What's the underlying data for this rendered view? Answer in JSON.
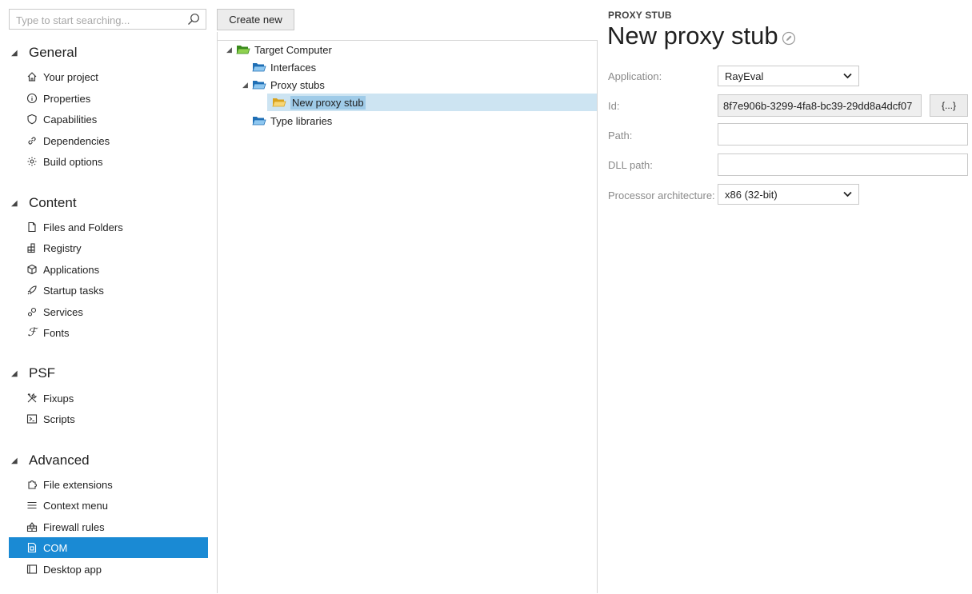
{
  "search": {
    "placeholder": "Type to start searching..."
  },
  "toolbar": {
    "create_label": "Create new"
  },
  "sidebar": {
    "sections": [
      {
        "label": "General",
        "items": [
          {
            "label": "Your project",
            "icon": "home-icon"
          },
          {
            "label": "Properties",
            "icon": "info-icon"
          },
          {
            "label": "Capabilities",
            "icon": "shield-icon"
          },
          {
            "label": "Dependencies",
            "icon": "link-icon"
          },
          {
            "label": "Build options",
            "icon": "gear-icon"
          }
        ]
      },
      {
        "label": "Content",
        "items": [
          {
            "label": "Files and Folders",
            "icon": "file-icon"
          },
          {
            "label": "Registry",
            "icon": "registry-icon"
          },
          {
            "label": "Applications",
            "icon": "package-icon"
          },
          {
            "label": "Startup tasks",
            "icon": "rocket-icon"
          },
          {
            "label": "Services",
            "icon": "services-icon"
          },
          {
            "label": "Fonts",
            "icon": "font-icon"
          }
        ]
      },
      {
        "label": "PSF",
        "items": [
          {
            "label": "Fixups",
            "icon": "tools-icon"
          },
          {
            "label": "Scripts",
            "icon": "script-icon"
          }
        ]
      },
      {
        "label": "Advanced",
        "items": [
          {
            "label": "File extensions",
            "icon": "puzzle-icon"
          },
          {
            "label": "Context menu",
            "icon": "menu-icon"
          },
          {
            "label": "Firewall rules",
            "icon": "firewall-icon"
          },
          {
            "label": "COM",
            "icon": "com-icon",
            "active": true
          },
          {
            "label": "Desktop app",
            "icon": "desktop-icon"
          }
        ]
      }
    ]
  },
  "tree": {
    "root": "Target Computer",
    "interfaces": "Interfaces",
    "proxy_stubs": "Proxy stubs",
    "new_proxy_stub": "New proxy stub",
    "type_libraries": "Type libraries"
  },
  "detail": {
    "kicker": "PROXY STUB",
    "title": "New proxy stub",
    "application_label": "Application:",
    "application_value": "RayEval",
    "id_label": "Id:",
    "id_value": "8f7e906b-3299-4fa8-bc39-29dd8a4dcf07",
    "id_button": "{...}",
    "path_label": "Path:",
    "path_value": "",
    "dll_label": "DLL path:",
    "dll_value": "",
    "arch_label": "Processor architecture:",
    "arch_value": "x86 (32-bit)"
  },
  "colors": {
    "accent": "#1a8ad4",
    "selection": "#cde4f2"
  }
}
